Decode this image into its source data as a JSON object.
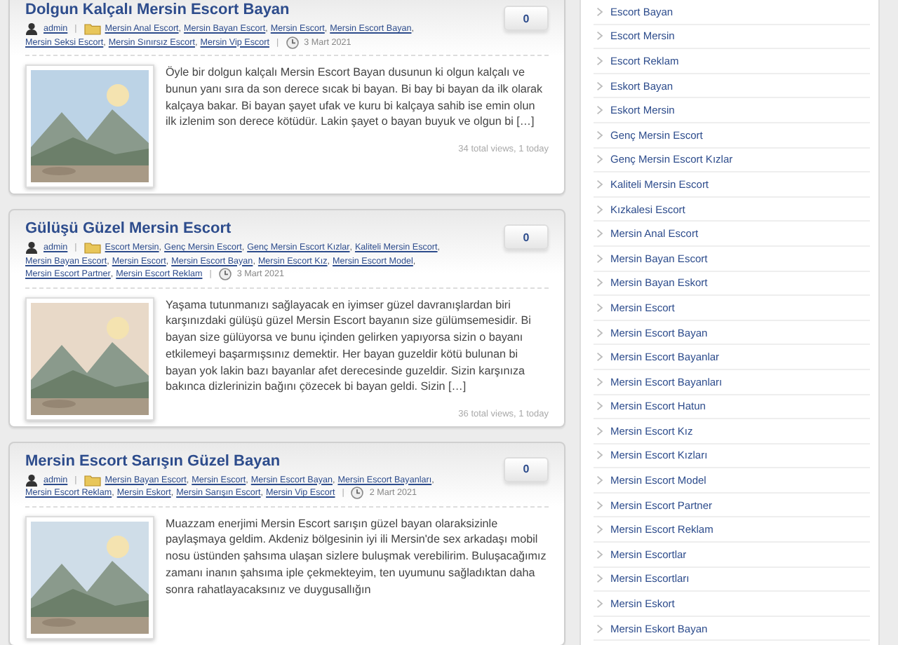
{
  "meta_separator": "|",
  "list_separator": ",",
  "posts": [
    {
      "title": "Dolgun Kalçalı Mersin Escort Bayan",
      "comments": "0",
      "author": "admin",
      "categories": [
        "Mersin Anal Escort",
        "Mersin Bayan Escort",
        "Mersin Escort",
        "Mersin Escort Bayan",
        "Mersin Seksi Escort",
        "Mersin Sınırsız Escort",
        "Mersin Vip Escort"
      ],
      "date": "3 Mart 2021",
      "image": {
        "kind": "picture"
      },
      "excerpt": "Öyle bir dolgun kalçalı Mersin Escort Bayan dusunun ki olgun kalçalı ve bunun yanı sıra da son derece sıcak bi bayan. Bi bay bi bayan da ilk olarak kalçaya bakar. Bi bayan şayet ufak ve kuru bi kalçaya sahib ise emin olun ilk izlenim son derece kötüdür. Lakin şayet o bayan buyuk ve olgun bi […]",
      "views": "34 total views, 1 today"
    },
    {
      "title": "Gülüşü Güzel Mersin Escort",
      "comments": "0",
      "author": "admin",
      "categories": [
        "Escort Mersin",
        "Genç Mersin Escort",
        "Genç Mersin Escort Kızlar",
        "Kaliteli Mersin Escort",
        "Mersin Bayan Escort",
        "Mersin Escort",
        "Mersin Escort Bayan",
        "Mersin Escort Kız",
        "Mersin Escort Model",
        "Mersin Escort Partner",
        "Mersin Escort Reklam"
      ],
      "date": "3 Mart 2021",
      "image": {
        "kind": "picture"
      },
      "excerpt": "Yaşama tutunmanızı sağlayacak en iyimser güzel davranışlardan biri karşınızdaki gülüşü güzel Mersin Escort bayanın size gülümsemesidir. Bi bayan size gülüyorsa ve bunu içinden gelirken yapıyorsa sizin o bayanı etkilemeyi başarmışsınız demektir. Her bayan guzeldir kötü bulunan bi bayan yok lakin bazı bayanlar afet derecesinde guzeldir. Sizin karşınıza bakınca dizlerinizin bağını çözecek bi bayan geldi. Sizin […]",
      "views": "36 total views, 1 today"
    },
    {
      "title": "Mersin Escort Sarışın Güzel Bayan",
      "comments": "0",
      "author": "admin",
      "categories": [
        "Mersin Bayan Escort",
        "Mersin Escort",
        "Mersin Escort Bayan",
        "Mersin Escort Bayanları",
        "Mersin Escort Reklam",
        "Mersin Eskort",
        "Mersin Sarışın Escort",
        "Mersin Vip Escort"
      ],
      "date": "2 Mart 2021",
      "image": {
        "kind": "picture"
      },
      "excerpt": "Muazzam enerjimi Mersin Escort sarışın güzel bayan olaraksizinle paylaşmaya geldim. Akdeniz bölgesinin iyi ili Mersin'de sex arkadaşı mobil nosu üstünden şahsıma ulaşan sizlere buluşmak verebilirim. Buluşacağımız zamanı inanın şahsıma iple çekmekteyim, ten uyumunu sağladıktan daha sonra rahatlayacaksınız ve duygusallığın"
    }
  ],
  "sidebar": {
    "items": [
      "Escort Bayan",
      "Escort Mersin",
      "Escort Reklam",
      "Eskort Bayan",
      "Eskort Mersin",
      "Genç Mersin Escort",
      "Genç Mersin Escort Kızlar",
      "Kaliteli Mersin Escort",
      "Kızkalesi Escort",
      "Mersin Anal Escort",
      "Mersin Bayan Escort",
      "Mersin Bayan Eskort",
      "Mersin Escort",
      "Mersin Escort Bayan",
      "Mersin Escort Bayanlar",
      "Mersin Escort Bayanları",
      "Mersin Escort Hatun",
      "Mersin Escort Kız",
      "Mersin Escort Kızları",
      "Mersin Escort Model",
      "Mersin Escort Partner",
      "Mersin Escort Reklam",
      "Mersin Escortlar",
      "Mersin Escortları",
      "Mersin Eskort",
      "Mersin Eskort Bayan"
    ]
  }
}
